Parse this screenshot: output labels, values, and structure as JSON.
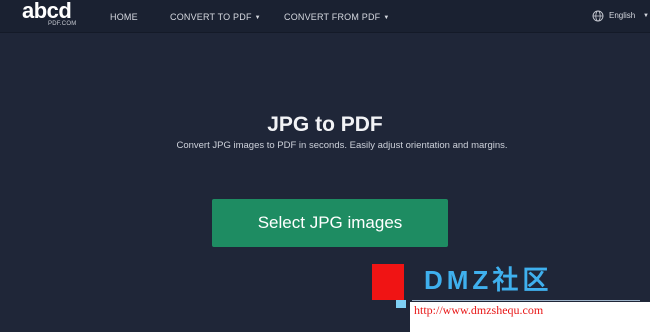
{
  "brand": {
    "name": "abcd",
    "sub": "PDF.COM"
  },
  "nav": {
    "home": "HOME",
    "convert_to": "CONVERT TO PDF",
    "convert_from": "CONVERT FROM PDF",
    "caret": "▼"
  },
  "language": {
    "label": "English",
    "icon": "globe-icon",
    "caret": "▼"
  },
  "main": {
    "title": "JPG to PDF",
    "subtitle": "Convert JPG images to PDF in seconds. Easily adjust orientation and margins.",
    "button_label": "Select JPG images"
  },
  "watermark": {
    "text": "DMZ社区",
    "url": "http://www.dmzshequ.com"
  },
  "colors": {
    "background": "#1f2638",
    "topbar": "#1a2131",
    "button": "#1e8c62",
    "watermark_blue": "#3fb0ee",
    "watermark_red": "#f01414"
  }
}
